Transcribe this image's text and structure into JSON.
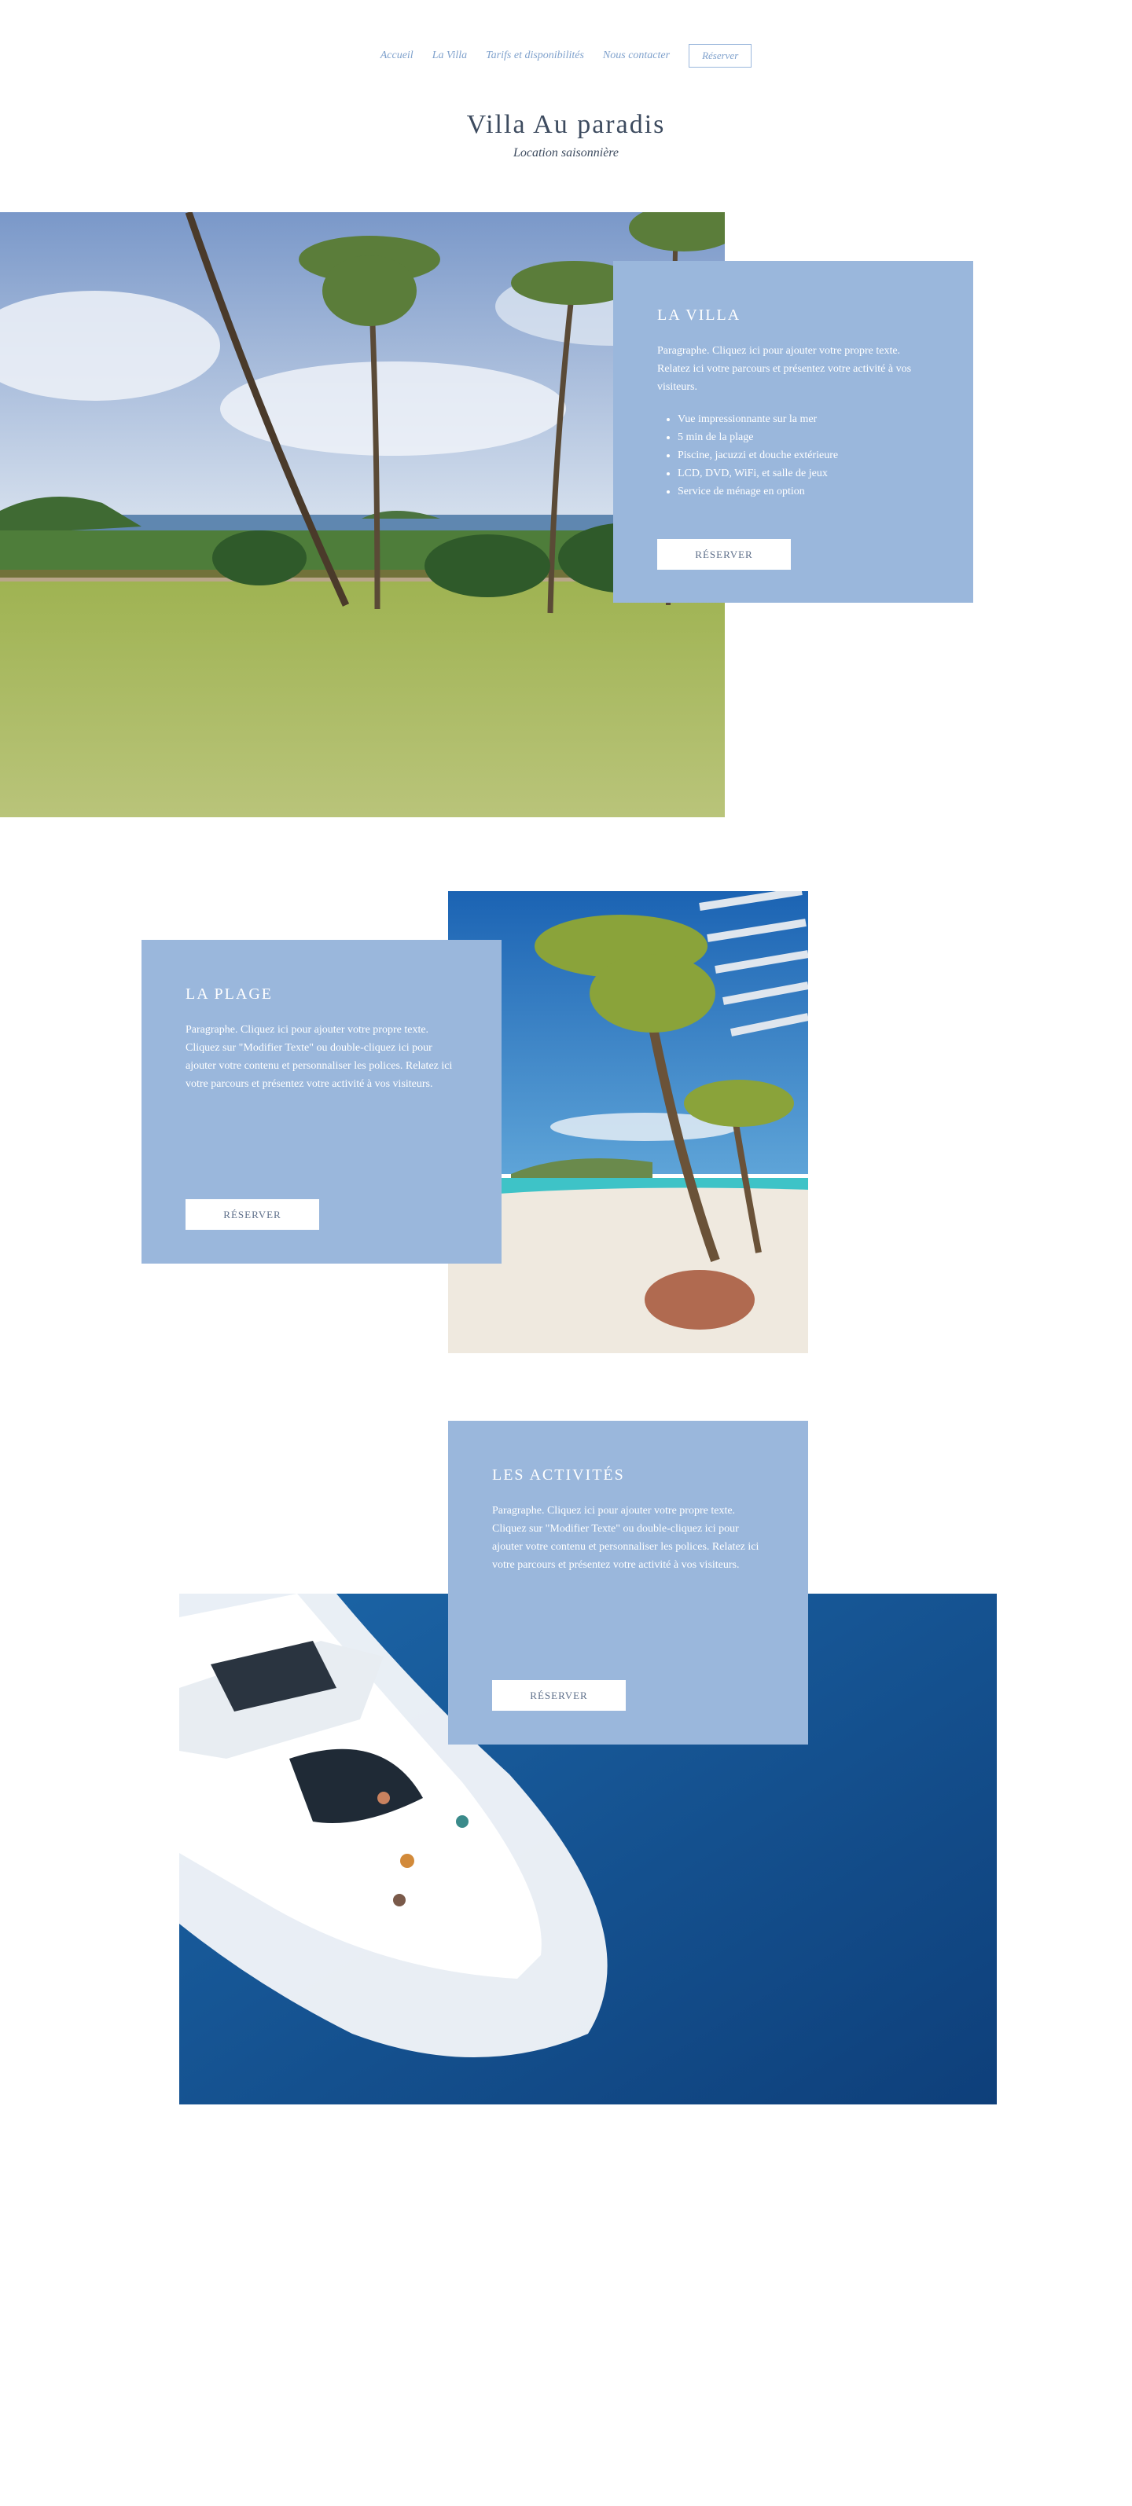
{
  "nav": {
    "items": [
      {
        "label": "Accueil"
      },
      {
        "label": "La Villa"
      },
      {
        "label": "Tarifs et disponibilités"
      },
      {
        "label": "Nous contacter"
      }
    ],
    "reserve_label": "Réserver"
  },
  "header": {
    "title": "Villa Au paradis",
    "subtitle": "Location saisonnière"
  },
  "villa": {
    "title": "LA VILLA",
    "paragraph": "Paragraphe. Cliquez ici pour ajouter votre propre texte. Relatez ici votre parcours et présentez votre activité à vos visiteurs.",
    "features": [
      "Vue impressionnante sur la mer",
      "5 min de la plage",
      "Piscine, jacuzzi et douche extérieure",
      "LCD, DVD, WiFi, et salle de jeux",
      "Service de ménage en option"
    ],
    "button": "RÉSERVER"
  },
  "plage": {
    "title": "LA PLAGE",
    "paragraph": "Paragraphe. Cliquez ici pour ajouter votre propre texte. Cliquez sur \"Modifier Texte\" ou double-cliquez ici pour ajouter votre contenu et personnaliser les polices. Relatez ici votre parcours et présentez votre activité à vos visiteurs.",
    "button": "RÉSERVER"
  },
  "activites": {
    "title": "LES ACTIVITÉS",
    "paragraph": "Paragraphe. Cliquez ici pour ajouter votre propre texte. Cliquez sur \"Modifier Texte\" ou double-cliquez ici pour ajouter votre contenu et personnaliser les polices. Relatez ici votre parcours et présentez votre activité à vos visiteurs.",
    "button": "RÉSERVER"
  },
  "colors": {
    "accent": "#9ab7dc",
    "nav_text": "#7fa1cc",
    "title_text": "#3d4b5f"
  }
}
